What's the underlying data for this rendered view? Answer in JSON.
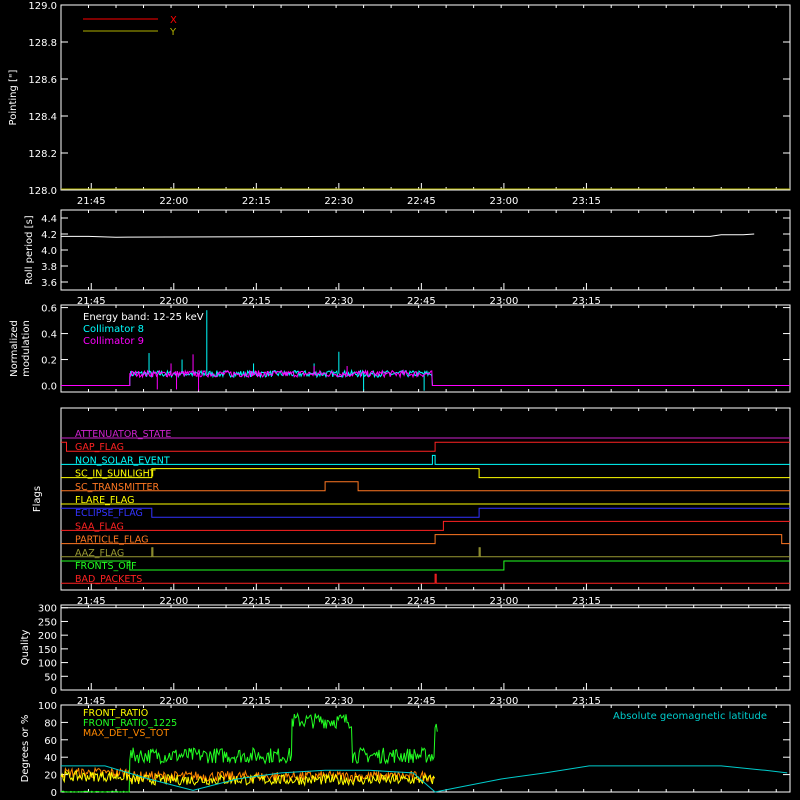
{
  "chart_data": [
    {
      "type": "line",
      "ylabel": "Pointing [\"]",
      "ylim": [
        128.0,
        129.0
      ],
      "yticks": [
        "128.0",
        "128.2",
        "128.4",
        "128.6",
        "128.8",
        "129.0"
      ],
      "xticks": [
        "21:45",
        "22:00",
        "22:15",
        "22:30",
        "22:45",
        "23:00",
        "23:15"
      ],
      "legend": [
        {
          "label": "X",
          "color": "#ff0000"
        },
        {
          "label": "Y",
          "color": "#b0b000"
        }
      ],
      "series": [
        {
          "name": "X",
          "color": "#ff0000",
          "values": []
        },
        {
          "name": "Y",
          "color": "#b0b000",
          "values": []
        }
      ]
    },
    {
      "type": "line",
      "ylabel": "Roll period [s]",
      "ylim": [
        3.5,
        4.5
      ],
      "yticks": [
        "3.6",
        "3.8",
        "4.0",
        "4.2",
        "4.4"
      ],
      "xticks": [
        "21:45",
        "22:00",
        "22:15",
        "22:30",
        "22:45",
        "23:00",
        "23:15"
      ],
      "series": [
        {
          "color": "#ffffff",
          "x_minutes": [
            0,
            5,
            10,
            50,
            100,
            118,
            120,
            124,
            126
          ],
          "values": [
            4.17,
            4.17,
            4.16,
            4.17,
            4.17,
            4.17,
            4.19,
            4.19,
            4.2
          ]
        }
      ]
    },
    {
      "type": "line",
      "ylabel": "Normalized modulation",
      "ylim": [
        -0.05,
        0.62
      ],
      "yticks": [
        "0.0",
        "0.2",
        "0.4",
        "0.6"
      ],
      "xticks": [
        "21:45",
        "22:00",
        "22:15",
        "22:30",
        "22:45",
        "23:00",
        "23:15"
      ],
      "annotation": "Energy band: 12-25 keV",
      "active_range_minutes": [
        12.5,
        67.5
      ],
      "series": [
        {
          "name": "Collimator 8",
          "color": "#00ffff",
          "baseline": 0.09,
          "spikes": [
            [
              16,
              0.25
            ],
            [
              22,
              0.2
            ],
            [
              26.5,
              0.58
            ],
            [
              35,
              0.17
            ],
            [
              46,
              0.17
            ],
            [
              50.5,
              0.26
            ],
            [
              55,
              -0.04
            ],
            [
              66,
              -0.04
            ]
          ]
        },
        {
          "name": "Collimator 9",
          "color": "#ff00ff",
          "baseline": 0.09,
          "spikes": [
            [
              20,
              0.17
            ],
            [
              24,
              0.24
            ],
            [
              17.5,
              -0.03
            ],
            [
              21,
              -0.03
            ],
            [
              25,
              -0.04
            ],
            [
              46,
              0.15
            ],
            [
              52,
              0.15
            ]
          ]
        }
      ]
    },
    {
      "type": "line",
      "ylabel": "Flags",
      "xticks": [
        "21:45",
        "22:00",
        "22:15",
        "22:30",
        "22:45",
        "23:00",
        "23:15"
      ],
      "flags": [
        {
          "name": "ATTENUATOR_STATE",
          "color": "#cc22cc",
          "steps": [
            [
              0,
              0
            ]
          ]
        },
        {
          "name": "GAP_FLAG",
          "color": "#ff2222",
          "steps": [
            [
              0,
              1
            ],
            [
              1,
              0
            ],
            [
              68,
              1
            ]
          ]
        },
        {
          "name": "NON_SOLAR_EVENT",
          "color": "#00ffff",
          "steps": [
            [
              0,
              0
            ],
            [
              67.5,
              1
            ],
            [
              68,
              0
            ]
          ]
        },
        {
          "name": "SC_IN_SUNLIGHT",
          "color": "#ffff00",
          "steps": [
            [
              0,
              0
            ],
            [
              16.5,
              1
            ],
            [
              76,
              0
            ]
          ]
        },
        {
          "name": "SC_TRANSMITTER",
          "color": "#ff7722",
          "steps": [
            [
              0,
              0
            ],
            [
              48,
              1
            ],
            [
              54,
              0
            ]
          ]
        },
        {
          "name": "FLARE_FLAG",
          "color": "#ffff00",
          "steps": [
            [
              0,
              0
            ]
          ]
        },
        {
          "name": "ECLIPSE_FLAG",
          "color": "#3333ff",
          "steps": [
            [
              0,
              1
            ],
            [
              16.5,
              0
            ],
            [
              76,
              1
            ]
          ]
        },
        {
          "name": "SAA_FLAG",
          "color": "#ff2222",
          "steps": [
            [
              0,
              0
            ],
            [
              69.5,
              1
            ]
          ]
        },
        {
          "name": "PARTICLE_FLAG",
          "color": "#ff7722",
          "steps": [
            [
              0,
              0
            ],
            [
              68,
              1
            ],
            [
              131,
              0
            ]
          ]
        },
        {
          "name": "AAZ_FLAG",
          "color": "#999933",
          "steps": [
            [
              0,
              0
            ],
            [
              16.5,
              1
            ],
            [
              16.7,
              0
            ],
            [
              76,
              1
            ],
            [
              76.2,
              0
            ]
          ]
        },
        {
          "name": "FRONTS_OFF",
          "color": "#22ff22",
          "steps": [
            [
              0,
              1
            ],
            [
              12.5,
              0
            ],
            [
              80.5,
              1
            ]
          ]
        },
        {
          "name": "BAD_PACKETS",
          "color": "#ff2222",
          "steps": [
            [
              0,
              0
            ],
            [
              68,
              1
            ],
            [
              68.2,
              0
            ]
          ]
        }
      ]
    },
    {
      "type": "line",
      "ylabel": "Quality",
      "ylim": [
        0,
        310
      ],
      "yticks": [
        "0",
        "50",
        "100",
        "150",
        "200",
        "250",
        "300"
      ],
      "xticks": [
        "21:45",
        "22:00",
        "22:15",
        "22:30",
        "22:45",
        "23:00",
        "23:15"
      ],
      "series": [
        {
          "color": "#ffffff",
          "x_minutes": [
            0,
            132
          ],
          "values": [
            300,
            300
          ]
        }
      ]
    },
    {
      "type": "line",
      "ylabel": "Degrees or %",
      "ylim": [
        0,
        100
      ],
      "yticks": [
        "0",
        "20",
        "40",
        "60",
        "80",
        "100"
      ],
      "legend": [
        {
          "label": "FRONT_RATIO",
          "color": "#ffff00"
        },
        {
          "label": "FRONT_RATIO_1225",
          "color": "#22ff22"
        },
        {
          "label": "MAX_DET_VS_TOT",
          "color": "#ff8800"
        },
        {
          "label": "Absolute geomagnetic latitude",
          "color": "#00cccc"
        }
      ],
      "series": [
        {
          "name": "FRONT_RATIO_1225",
          "color": "#22ff22",
          "segments": [
            [
              0,
              12.5,
              0
            ],
            [
              12.5,
              42,
              42
            ],
            [
              42,
              53,
              82
            ],
            [
              53,
              68,
              42
            ],
            [
              68,
              68.5,
              72
            ]
          ]
        },
        {
          "name": "MAX_DET_VS_TOT",
          "color": "#ff8800",
          "segments": [
            [
              0,
              12.5,
              22
            ],
            [
              12.5,
              68,
              18
            ]
          ]
        },
        {
          "name": "FRONT_RATIO",
          "color": "#ffff00",
          "segments": [
            [
              0,
              12.5,
              18
            ],
            [
              12.5,
              68,
              14
            ]
          ]
        },
        {
          "name": "Absolute geomagnetic latitude",
          "color": "#00cccc",
          "x_minutes": [
            0,
            8,
            16,
            24,
            32,
            40,
            48,
            56,
            64,
            68,
            72,
            80,
            88,
            96,
            104,
            112,
            120,
            128,
            132
          ],
          "values": [
            30,
            30,
            15,
            2,
            15,
            22,
            25,
            25,
            22,
            0,
            5,
            15,
            22,
            30,
            30,
            30,
            30,
            25,
            22
          ]
        }
      ]
    }
  ]
}
